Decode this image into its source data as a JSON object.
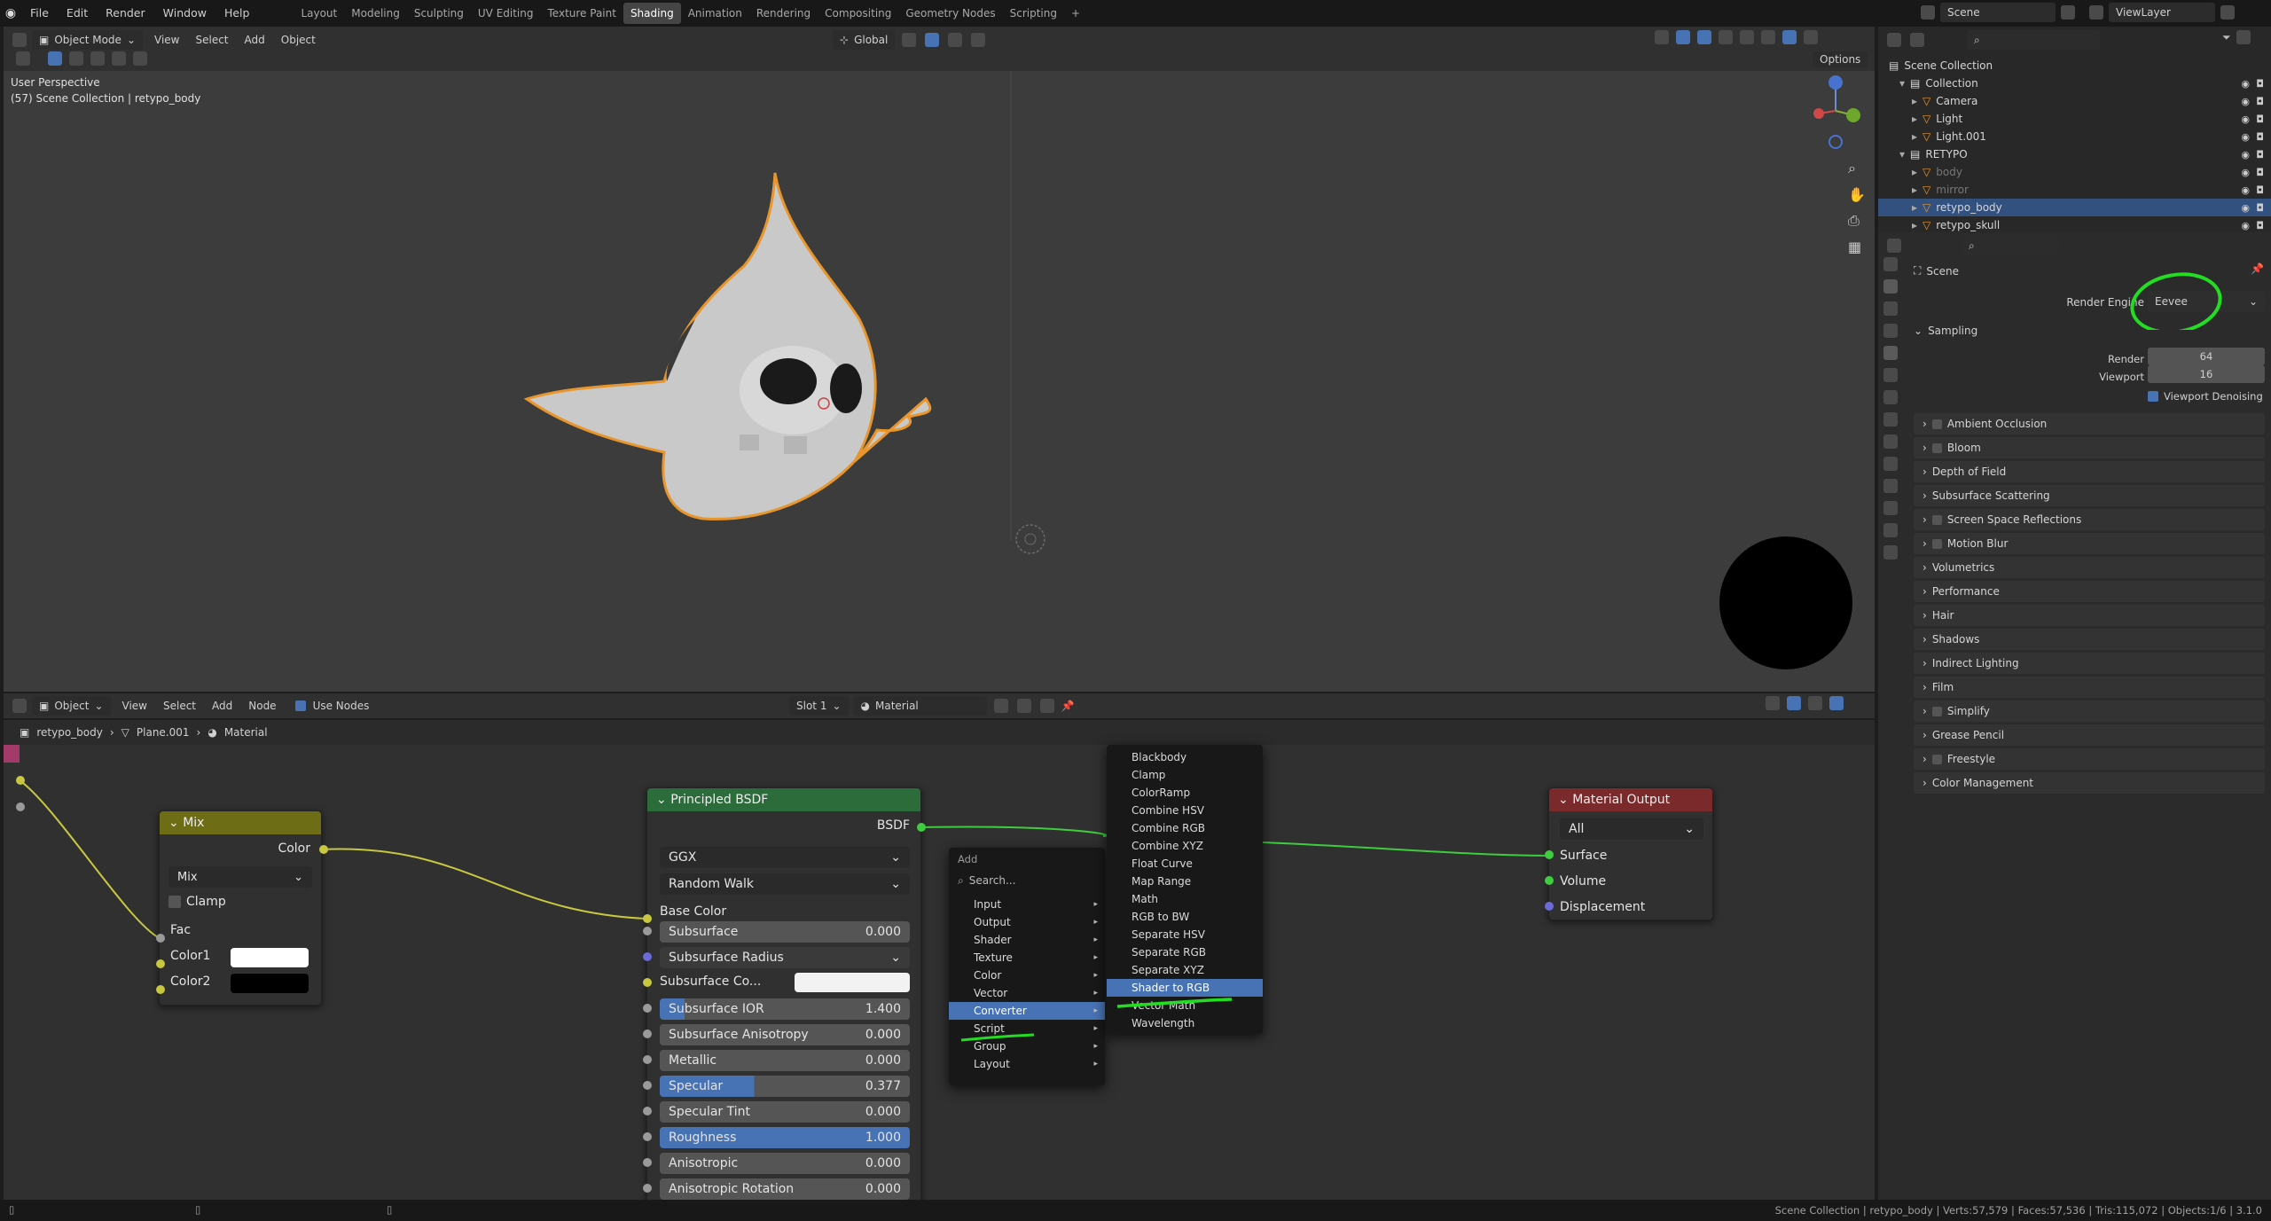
{
  "topbar": {
    "menus": [
      "File",
      "Edit",
      "Render",
      "Window",
      "Help"
    ],
    "workspaces": [
      "Layout",
      "Modeling",
      "Sculpting",
      "UV Editing",
      "Texture Paint",
      "Shading",
      "Animation",
      "Rendering",
      "Compositing",
      "Geometry Nodes",
      "Scripting"
    ],
    "active_workspace": "Shading",
    "scene": "Scene",
    "view_layer": "ViewLayer"
  },
  "viewport": {
    "mode": "Object Mode",
    "menus": [
      "View",
      "Select",
      "Add",
      "Object"
    ],
    "transform": "Global",
    "options": "Options",
    "info_line1": "User Perspective",
    "info_line2": "(57) Scene Collection | retypo_body"
  },
  "node_editor": {
    "type": "Object",
    "menus": [
      "View",
      "Select",
      "Add",
      "Node"
    ],
    "use_nodes": "Use Nodes",
    "slot": "Slot 1",
    "material": "Material",
    "breadcrumb": [
      "retypo_body",
      "Plane.001",
      "Material"
    ]
  },
  "mix_node": {
    "title": "Mix",
    "output": "Color",
    "blend": "Mix",
    "clamp": "Clamp",
    "inputs": [
      "Fac",
      "Color1",
      "Color2"
    ]
  },
  "principled_node": {
    "title": "Principled BSDF",
    "output": "BSDF",
    "distribution": "GGX",
    "subsurface_method": "Random Walk",
    "base_color": "Base Color",
    "rows": [
      {
        "label": "Subsurface",
        "value": "0.000"
      },
      {
        "label": "Subsurface Radius",
        "value": ""
      },
      {
        "label": "Subsurface Co...",
        "value": ""
      },
      {
        "label": "Subsurface IOR",
        "value": "1.400"
      },
      {
        "label": "Subsurface Anisotropy",
        "value": "0.000"
      },
      {
        "label": "Metallic",
        "value": "0.000"
      },
      {
        "label": "Specular",
        "value": "0.377"
      },
      {
        "label": "Specular Tint",
        "value": "0.000"
      },
      {
        "label": "Roughness",
        "value": "1.000"
      },
      {
        "label": "Anisotropic",
        "value": "0.000"
      },
      {
        "label": "Anisotropic Rotation",
        "value": "0.000"
      }
    ]
  },
  "output_node": {
    "title": "Material Output",
    "target": "All",
    "inputs": [
      "Surface",
      "Volume",
      "Displacement"
    ]
  },
  "add_menu": {
    "title": "Add",
    "search": "Search...",
    "items": [
      "Input",
      "Output",
      "Shader",
      "Texture",
      "Color",
      "Vector",
      "Converter",
      "Script",
      "Group",
      "Layout"
    ],
    "highlighted": "Converter"
  },
  "converter_menu": {
    "items": [
      "Blackbody",
      "Clamp",
      "ColorRamp",
      "Combine HSV",
      "Combine RGB",
      "Combine XYZ",
      "Float Curve",
      "Map Range",
      "Math",
      "RGB to BW",
      "Separate HSV",
      "Separate RGB",
      "Separate XYZ",
      "Shader to RGB",
      "Vector Math",
      "Wavelength"
    ],
    "highlighted": "Shader to RGB"
  },
  "outliner": {
    "root": "Scene Collection",
    "items": [
      {
        "name": "Collection",
        "depth": 1,
        "kind": "collection"
      },
      {
        "name": "Camera",
        "depth": 2,
        "kind": "object"
      },
      {
        "name": "Light",
        "depth": 2,
        "kind": "object"
      },
      {
        "name": "Light.001",
        "depth": 2,
        "kind": "object"
      },
      {
        "name": "RETYPO",
        "depth": 1,
        "kind": "collection"
      },
      {
        "name": "body",
        "depth": 2,
        "kind": "object",
        "dim": true
      },
      {
        "name": "mirror",
        "depth": 2,
        "kind": "object",
        "dim": true
      },
      {
        "name": "retypo_body",
        "depth": 2,
        "kind": "object",
        "selected": true
      },
      {
        "name": "retypo_skull",
        "depth": 2,
        "kind": "object"
      }
    ]
  },
  "properties": {
    "context": "Scene",
    "render_engine_label": "Render Engine",
    "render_engine": "Eevee",
    "sampling": "Sampling",
    "render_label": "Render",
    "render_value": "64",
    "viewport_label": "Viewport",
    "viewport_value": "16",
    "denoise": "Viewport Denoising",
    "panels": [
      {
        "name": "Ambient Occlusion",
        "checkbox": true
      },
      {
        "name": "Bloom",
        "checkbox": true
      },
      {
        "name": "Depth of Field",
        "checkbox": false
      },
      {
        "name": "Subsurface Scattering",
        "checkbox": false
      },
      {
        "name": "Screen Space Reflections",
        "checkbox": true
      },
      {
        "name": "Motion Blur",
        "checkbox": true
      },
      {
        "name": "Volumetrics",
        "checkbox": false
      },
      {
        "name": "Performance",
        "checkbox": false
      },
      {
        "name": "Hair",
        "checkbox": false
      },
      {
        "name": "Shadows",
        "checkbox": false
      },
      {
        "name": "Indirect Lighting",
        "checkbox": false
      },
      {
        "name": "Film",
        "checkbox": false
      },
      {
        "name": "Simplify",
        "checkbox": true
      },
      {
        "name": "Grease Pencil",
        "checkbox": false
      },
      {
        "name": "Freestyle",
        "checkbox": true
      },
      {
        "name": "Color Management",
        "checkbox": false
      }
    ]
  },
  "status": {
    "text": "Scene Collection | retypo_body | Verts:57,579 | Faces:57,536 | Tris:115,072 | Objects:1/6 | 3.1.0"
  },
  "colors": {
    "accent": "#4772b3",
    "selection_orange": "#e8962c",
    "annotation_green": "#22dd22",
    "mix_header": "#6d6d16",
    "bsdf_header": "#2c6b3a",
    "output_header": "#7a2a2a"
  }
}
